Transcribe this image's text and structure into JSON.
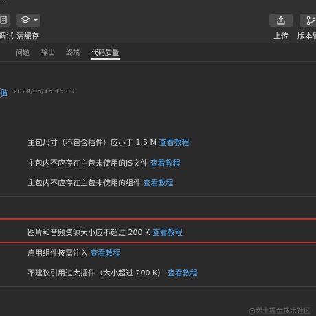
{
  "toolbar": {
    "title": "...",
    "left_buttons": [
      {
        "label": "调试",
        "icon": "debug-icon"
      },
      {
        "label": "清缓存",
        "icon": "layers-icon"
      }
    ],
    "right_buttons": [
      {
        "label": "上传",
        "icon": "upload-icon"
      },
      {
        "label": "版本管",
        "icon": "version-icon"
      }
    ]
  },
  "tabs": [
    {
      "label": "问题",
      "active": false
    },
    {
      "label": "输出",
      "active": false
    },
    {
      "label": "终端",
      "active": false
    },
    {
      "label": "代码质量",
      "active": true
    }
  ],
  "scan": {
    "link_text": "描",
    "timestamp": "2024/05/15 16:09"
  },
  "rows": [
    {
      "text": "主包尺寸（不包含插件）应小于 1.5 M ",
      "link": "查看教程"
    },
    {
      "text": "主包内不应存在主包未使用的JS文件 ",
      "link": "查看教程"
    },
    {
      "text": "主包内不应存在主包未使用的组件 ",
      "link": "查看教程"
    },
    {
      "text": "图片和音频资源大小应不超过 200 K ",
      "link": "查看教程"
    },
    {
      "text": "启用组件按需注入 ",
      "link": "查看教程"
    },
    {
      "text": "不建议引用过大插件（大小超过 200 K） ",
      "link": "查看教程"
    }
  ],
  "watermark": "@稀土掘金技术社区",
  "colors": {
    "background": "#2b2b2b",
    "toolbar": "#303030",
    "link": "#4aa3f0",
    "highlight_border": "#c12a2a"
  }
}
